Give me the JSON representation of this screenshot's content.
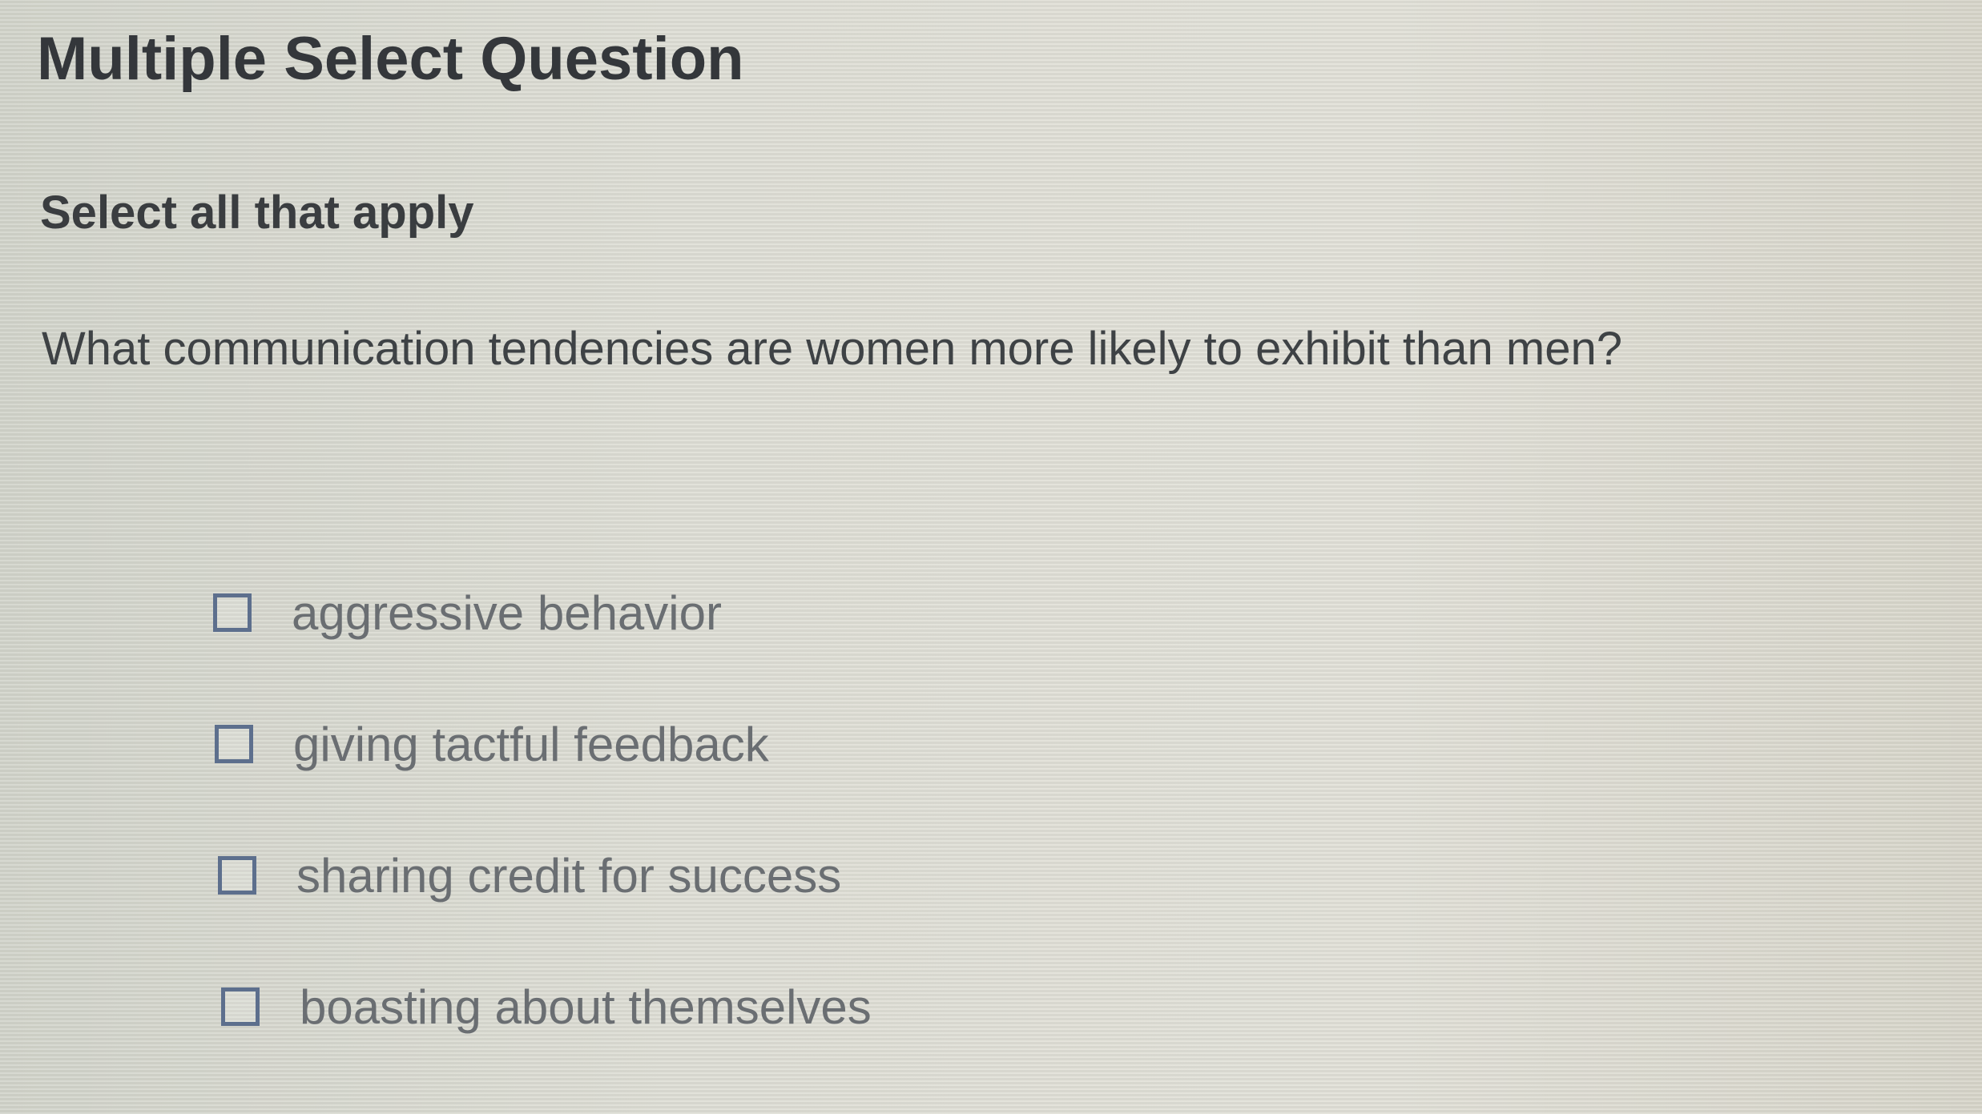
{
  "question": {
    "type_label": "Multiple Select Question",
    "instruction": "Select all that apply",
    "prompt": "What communication tendencies are women more likely to exhibit than men?"
  },
  "options": [
    {
      "label": "aggressive behavior",
      "checked": false
    },
    {
      "label": "giving tactful feedback",
      "checked": false
    },
    {
      "label": "sharing credit for success",
      "checked": false
    },
    {
      "label": "boasting about themselves",
      "checked": false
    }
  ],
  "colors": {
    "checkbox_border": "#5d6f8d",
    "text_dark": "#34373b",
    "option_text": "#6a6e72"
  }
}
